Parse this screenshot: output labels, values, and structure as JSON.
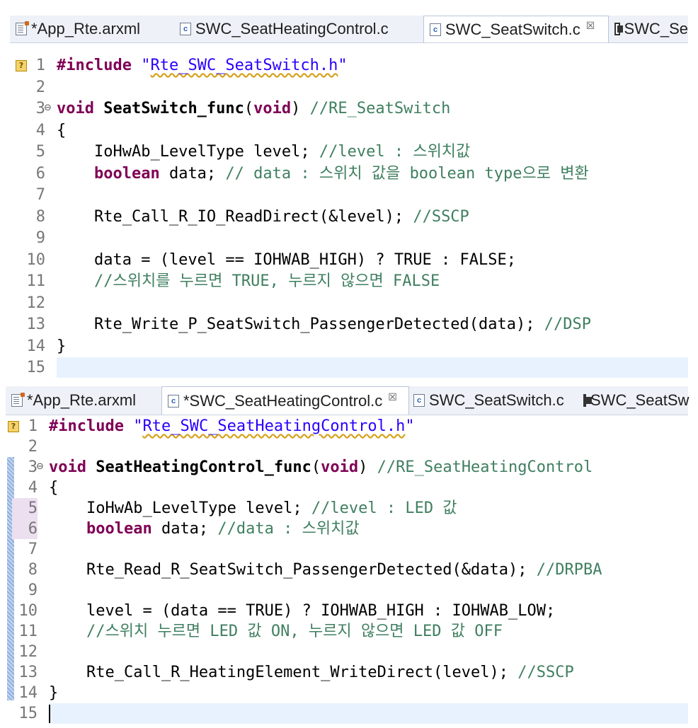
{
  "top_editor": {
    "tabs": [
      {
        "label": "*App_Rte.arxml",
        "icon": "xml-file-icon",
        "active": false
      },
      {
        "label": "SWC_SeatHeatingControl.c",
        "icon": "c-file-icon",
        "active": false
      },
      {
        "label": "SWC_SeatSwitch.c",
        "icon": "c-file-icon",
        "active": true,
        "close": "☒"
      },
      {
        "label": "SWC_Se",
        "icon": "component-icon",
        "active": false
      }
    ],
    "lines": [
      {
        "n": "1",
        "html": "<span class=\"kw\">#include</span> <span class=\"str\">\"<span class=\"warn\">Rte_SWC_SeatSwitch.h</span>\"</span>"
      },
      {
        "n": "2",
        "html": ""
      },
      {
        "n": "3",
        "html": "<span class=\"kw\">void</span> <span class=\"fn\">SeatSwitch_func</span>(<span class=\"kw\">void</span>) <span class=\"cm\">//RE_SeatSwitch</span>"
      },
      {
        "n": "4",
        "html": "{"
      },
      {
        "n": "5",
        "html": "    IoHwAb_LevelType level; <span class=\"cm\">//level : 스위치값</span>"
      },
      {
        "n": "6",
        "html": "    <span class=\"kw\">boolean</span> data; <span class=\"cm\">// data : 스위치 값을 boolean type으로 변환</span>"
      },
      {
        "n": "7",
        "html": ""
      },
      {
        "n": "8",
        "html": "    Rte_Call_R_IO_ReadDirect(&amp;level); <span class=\"cm\">//SSCP</span>"
      },
      {
        "n": "9",
        "html": ""
      },
      {
        "n": "10",
        "html": "    data = (level == IOHWAB_HIGH) ? TRUE : FALSE;"
      },
      {
        "n": "11",
        "html": "    <span class=\"cm\">//스위치를 누르면 TRUE, 누르지 않으면 FALSE</span>"
      },
      {
        "n": "12",
        "html": ""
      },
      {
        "n": "13",
        "html": "    Rte_Write_P_SeatSwitch_PassengerDetected(data); <span class=\"cm\">//DSP</span>"
      },
      {
        "n": "14",
        "html": "}"
      },
      {
        "n": "15",
        "html": ""
      }
    ]
  },
  "bottom_editor": {
    "tabs": [
      {
        "label": "*App_Rte.arxml",
        "icon": "xml-file-icon",
        "active": false
      },
      {
        "label": "*SWC_SeatHeatingControl.c",
        "icon": "c-file-icon",
        "active": true,
        "close": "☒"
      },
      {
        "label": "SWC_SeatSwitch.c",
        "icon": "c-file-icon",
        "active": false
      },
      {
        "label": "SWC_SeatSw",
        "icon": "component-icon",
        "active": false
      }
    ],
    "lines": [
      {
        "n": "1",
        "html": "<span class=\"kw\">#include</span> <span class=\"str\">\"<span class=\"warn\">Rte_SWC_SeatHeatingControl.h</span>\"</span>"
      },
      {
        "n": "2",
        "html": ""
      },
      {
        "n": "3",
        "html": "<span class=\"kw\">void</span> <span class=\"fn\">SeatHeatingControl_func</span>(<span class=\"kw\">void</span>) <span class=\"cm\">//RE_SeatHeatingControl</span>"
      },
      {
        "n": "4",
        "html": "{"
      },
      {
        "n": "5",
        "html": "    IoHwAb_LevelType level; <span class=\"cm\">//level : LED 값</span>"
      },
      {
        "n": "6",
        "html": "    <span class=\"kw\">boolean</span> data; <span class=\"cm\">//data : 스위치값</span>"
      },
      {
        "n": "7",
        "html": ""
      },
      {
        "n": "8",
        "html": "    Rte_Read_R_SeatSwitch_PassengerDetected(&amp;data); <span class=\"cm\">//DRPBA</span>"
      },
      {
        "n": "9",
        "html": ""
      },
      {
        "n": "10",
        "html": "    level = (data == TRUE) ? IOHWAB_HIGH : IOHWAB_LOW;"
      },
      {
        "n": "11",
        "html": "    <span class=\"cm\">//스위치 누르면 LED 값 ON, 누르지 않으면 LED 값 OFF</span>"
      },
      {
        "n": "12",
        "html": ""
      },
      {
        "n": "13",
        "html": "    Rte_Call_R_HeatingElement_WriteDirect(level); <span class=\"cm\">//SSCP</span>"
      },
      {
        "n": "14",
        "html": "}"
      },
      {
        "n": "15",
        "html": ""
      }
    ]
  },
  "markers": {
    "warning_glyph": "?",
    "fold_glyph": "⊖",
    "c_icon_glyph": "c"
  }
}
